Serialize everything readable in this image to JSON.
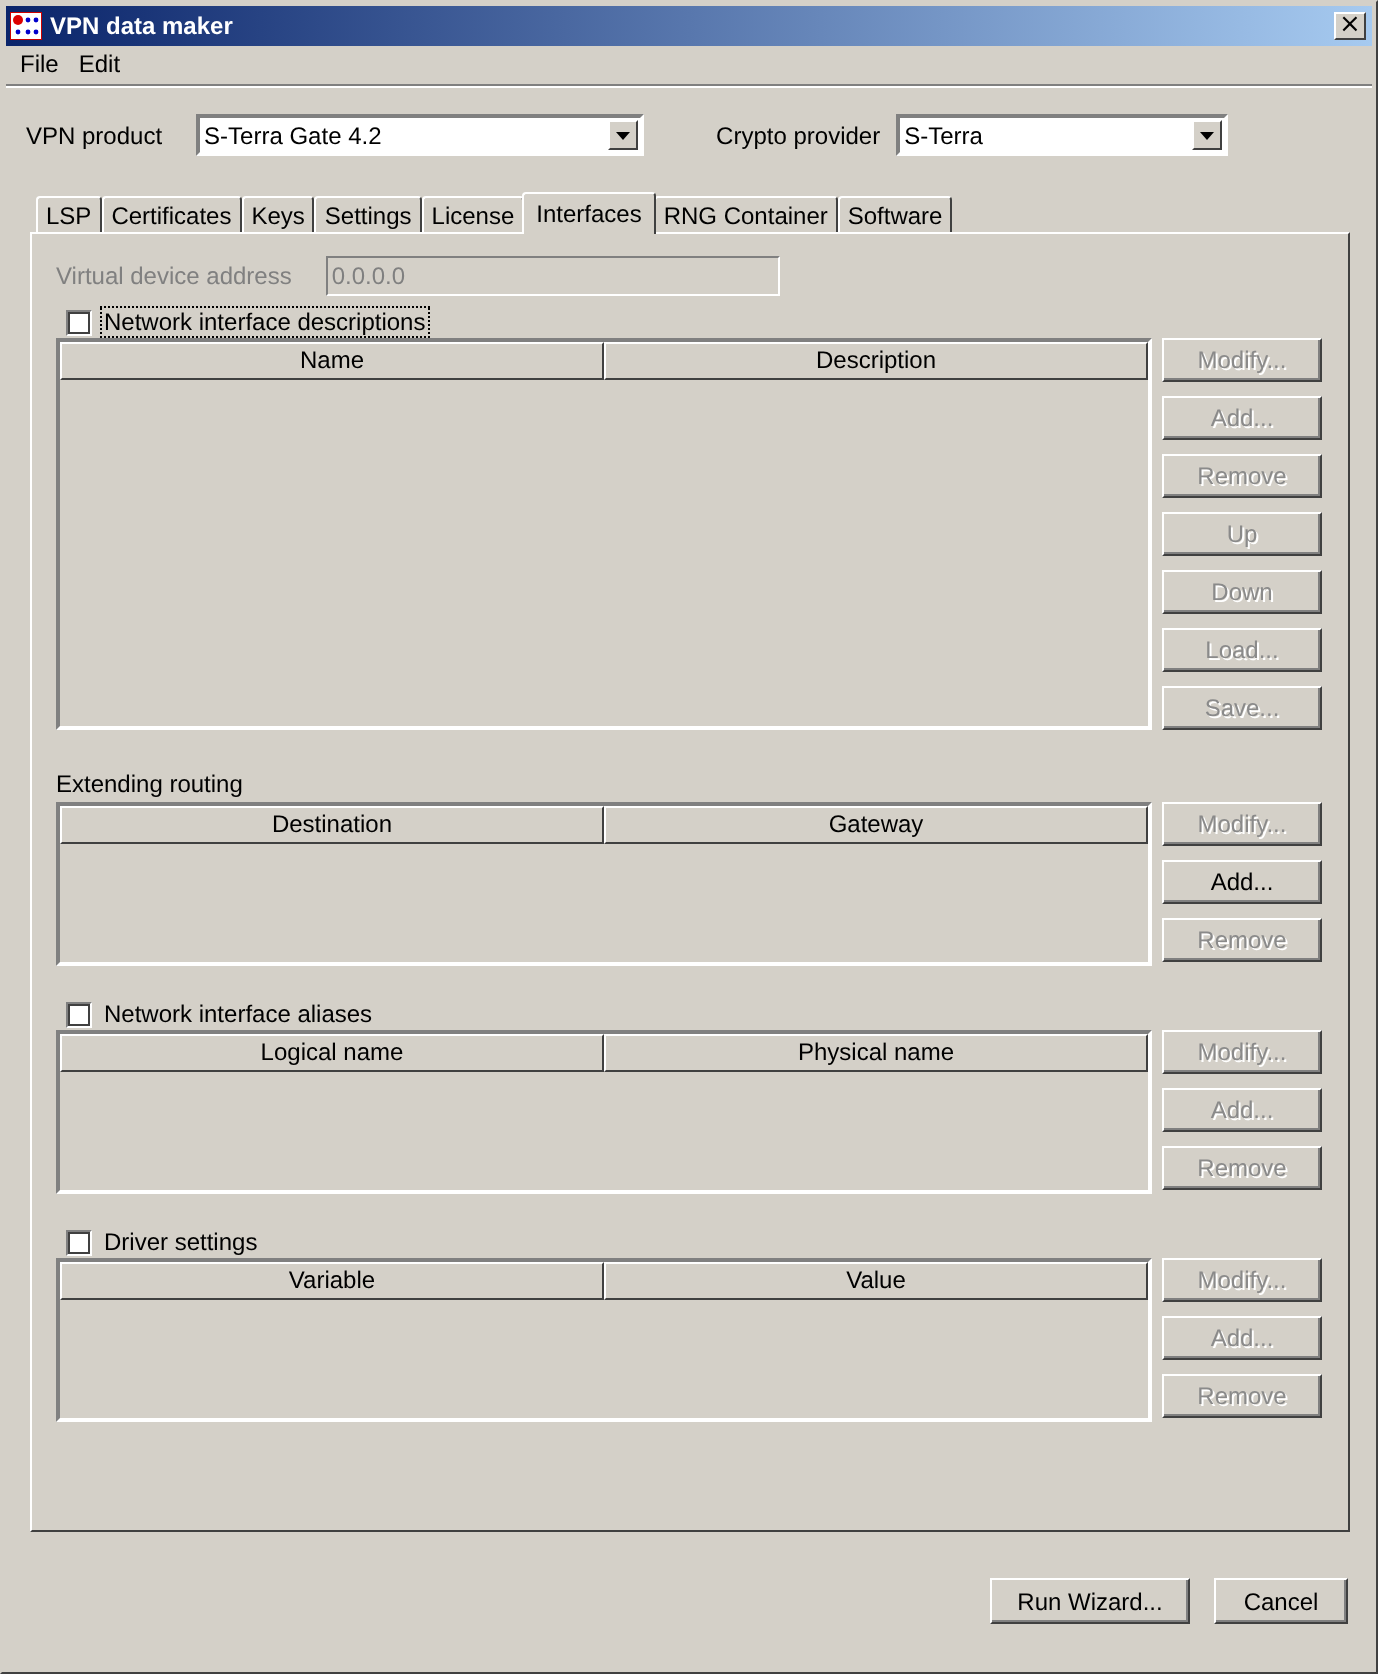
{
  "window": {
    "title": "VPN data maker",
    "close": "×"
  },
  "menu": [
    "File",
    "Edit"
  ],
  "vpn_product": {
    "label": "VPN product",
    "value": "S-Terra Gate 4.2"
  },
  "crypto_provider": {
    "label": "Crypto provider",
    "value": "S-Terra"
  },
  "tabs": [
    {
      "label": "LSP",
      "selected": false
    },
    {
      "label": "Certificates",
      "selected": false
    },
    {
      "label": "Keys",
      "selected": false
    },
    {
      "label": "Settings",
      "selected": false
    },
    {
      "label": "License",
      "selected": false
    },
    {
      "label": "Interfaces",
      "selected": true
    },
    {
      "label": "RNG Container",
      "selected": false
    },
    {
      "label": "Software",
      "selected": false
    }
  ],
  "virtual_device_address": {
    "label": "Virtual device address",
    "value": "0.0.0.0",
    "disabled": true
  },
  "sections": [
    {
      "kind": "checkbox",
      "label": "Network interface descriptions",
      "checked": false,
      "focused": true,
      "columns": [
        "Name",
        "Description"
      ],
      "buttons": [
        {
          "label": "Modify...",
          "disabled": true
        },
        {
          "label": "Add...",
          "disabled": true
        },
        {
          "label": "Remove",
          "disabled": true
        },
        {
          "label": "Up",
          "disabled": true
        },
        {
          "label": "Down",
          "disabled": true
        },
        {
          "label": "Load...",
          "disabled": true
        },
        {
          "label": "Save...",
          "disabled": true
        }
      ]
    },
    {
      "kind": "label",
      "label": "Extending routing",
      "columns": [
        "Destination",
        "Gateway"
      ],
      "buttons": [
        {
          "label": "Modify...",
          "disabled": true
        },
        {
          "label": "Add...",
          "disabled": false
        },
        {
          "label": "Remove",
          "disabled": true
        }
      ]
    },
    {
      "kind": "checkbox",
      "label": "Network interface aliases",
      "checked": false,
      "focused": false,
      "columns": [
        "Logical name",
        "Physical name"
      ],
      "buttons": [
        {
          "label": "Modify...",
          "disabled": true
        },
        {
          "label": "Add...",
          "disabled": true
        },
        {
          "label": "Remove",
          "disabled": true
        }
      ]
    },
    {
      "kind": "checkbox",
      "label": "Driver settings",
      "checked": false,
      "focused": false,
      "columns": [
        "Variable",
        "Value"
      ],
      "buttons": [
        {
          "label": "Modify...",
          "disabled": true
        },
        {
          "label": "Add...",
          "disabled": true
        },
        {
          "label": "Remove",
          "disabled": true
        }
      ]
    }
  ],
  "footer_buttons": [
    "Run Wizard...",
    "Cancel"
  ]
}
